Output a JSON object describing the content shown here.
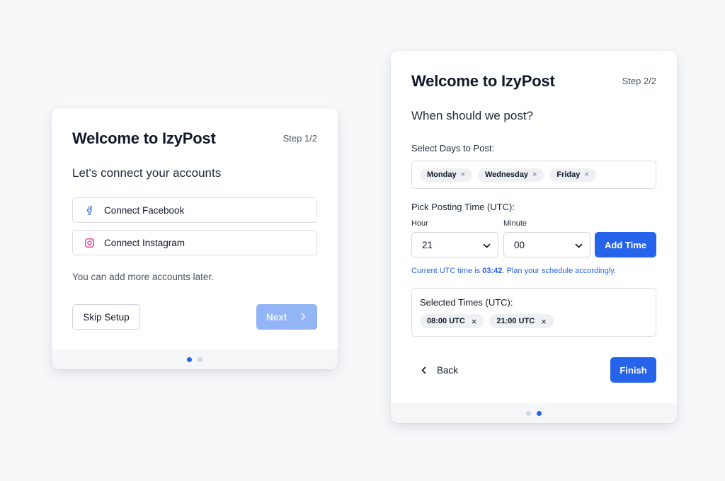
{
  "colors": {
    "accent": "#2563eb",
    "accent_disabled": "#93b4f5",
    "facebook": "#2563eb",
    "instagram": "#db2777"
  },
  "step1": {
    "title": "Welcome to IzyPost",
    "step": "Step 1/2",
    "subtitle": "Let's connect your accounts",
    "connect_facebook": {
      "icon": "facebook-icon",
      "label": "Connect Facebook"
    },
    "connect_instagram": {
      "icon": "instagram-icon",
      "label": "Connect Instagram"
    },
    "note": "You can add more accounts later.",
    "skip_label": "Skip Setup",
    "next_label": "Next",
    "next_icon": "chevron-right-icon"
  },
  "step2": {
    "title": "Welcome to IzyPost",
    "step": "Step 2/2",
    "subtitle": "When should we post?",
    "days_label": "Select Days to Post:",
    "days": [
      "Monday",
      "Wednesday",
      "Friday"
    ],
    "remove_glyph": "×",
    "time_label": "Pick Posting Time (UTC):",
    "hour_label": "Hour",
    "hour_value": "21",
    "minute_label": "Minute",
    "minute_value": "00",
    "add_time_label": "Add Time",
    "utc_note_prefix": "Current UTC time is ",
    "utc_time": "03:42",
    "utc_note_suffix": ". Plan your schedule accordingly.",
    "selected_times_title": "Selected Times (UTC):",
    "selected_times": [
      "08:00 UTC",
      "21:00 UTC"
    ],
    "back_label": "Back",
    "finish_label": "Finish"
  }
}
